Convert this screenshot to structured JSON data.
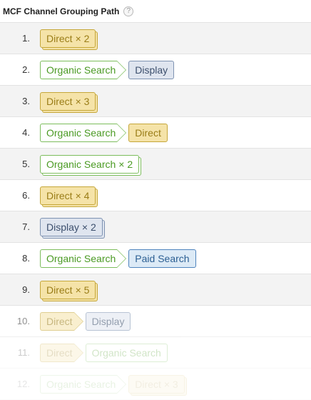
{
  "header": {
    "title": "MCF Channel Grouping Path",
    "help_glyph": "?"
  },
  "rows": [
    {
      "num": "1.",
      "chips": [
        {
          "label": "Direct",
          "mult": "× 2",
          "type": "direct"
        }
      ]
    },
    {
      "num": "2.",
      "chips": [
        {
          "label": "Organic Search",
          "type": "organic"
        },
        {
          "label": "Display",
          "type": "display"
        }
      ]
    },
    {
      "num": "3.",
      "chips": [
        {
          "label": "Direct",
          "mult": "× 3",
          "type": "direct"
        }
      ]
    },
    {
      "num": "4.",
      "chips": [
        {
          "label": "Organic Search",
          "type": "organic"
        },
        {
          "label": "Direct",
          "type": "direct"
        }
      ]
    },
    {
      "num": "5.",
      "chips": [
        {
          "label": "Organic Search",
          "mult": "× 2",
          "type": "organic"
        }
      ]
    },
    {
      "num": "6.",
      "chips": [
        {
          "label": "Direct",
          "mult": "× 4",
          "type": "direct"
        }
      ]
    },
    {
      "num": "7.",
      "chips": [
        {
          "label": "Display",
          "mult": "× 2",
          "type": "display"
        }
      ]
    },
    {
      "num": "8.",
      "chips": [
        {
          "label": "Organic Search",
          "type": "organic"
        },
        {
          "label": "Paid Search",
          "type": "paid"
        }
      ]
    },
    {
      "num": "9.",
      "chips": [
        {
          "label": "Direct",
          "mult": "× 5",
          "type": "direct"
        }
      ]
    },
    {
      "num": "10.",
      "chips": [
        {
          "label": "Direct",
          "type": "direct"
        },
        {
          "label": "Display",
          "type": "display"
        }
      ]
    },
    {
      "num": "11.",
      "chips": [
        {
          "label": "Direct",
          "type": "direct"
        },
        {
          "label": "Organic Search",
          "type": "organic"
        }
      ]
    },
    {
      "num": "12.",
      "chips": [
        {
          "label": "Organic Search",
          "type": "organic"
        },
        {
          "label": "Direct",
          "mult": "× 3",
          "type": "direct"
        }
      ]
    }
  ]
}
